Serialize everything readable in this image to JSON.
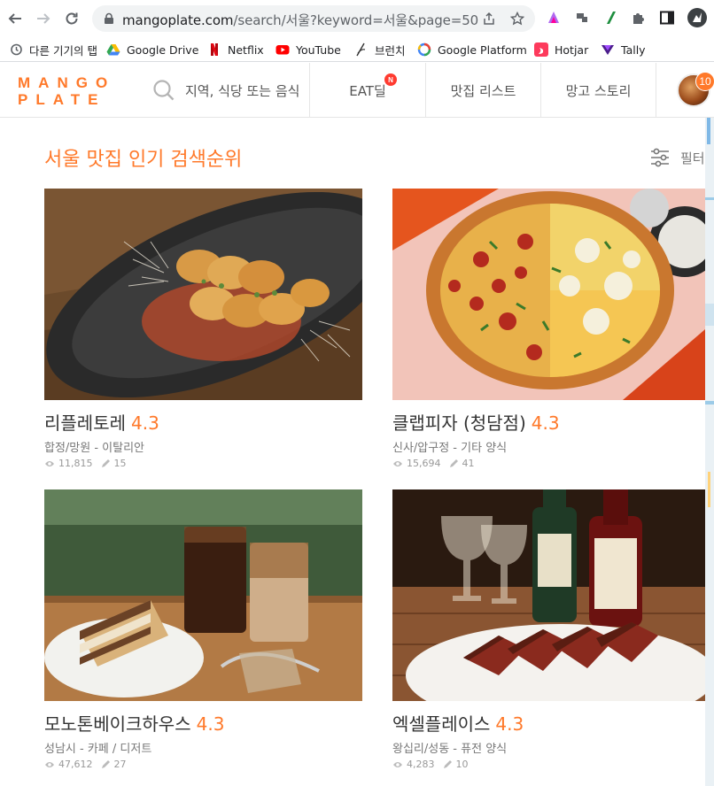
{
  "browser": {
    "url_host": "mangoplate.com",
    "url_path": "/search/서울?keyword=서울&page=50",
    "bookmarks": [
      {
        "label": "다른 기기의 탭",
        "icon": "history-icon"
      },
      {
        "label": "Google Drive",
        "icon": "google-drive-icon"
      },
      {
        "label": "Netflix",
        "icon": "netflix-icon"
      },
      {
        "label": "YouTube",
        "icon": "youtube-icon"
      },
      {
        "label": "브런치",
        "icon": "brunch-icon"
      },
      {
        "label": "Google Platform",
        "icon": "google-platform-icon"
      },
      {
        "label": "Hotjar",
        "icon": "hotjar-icon"
      },
      {
        "label": "Tally",
        "icon": "tally-icon"
      }
    ]
  },
  "header": {
    "logo_line1": "MANGO",
    "logo_line2": "PLATE",
    "search_placeholder": "지역, 식당 또는 음식",
    "nav": [
      {
        "label": "EAT딜",
        "badge": "N"
      },
      {
        "label": "맛집 리스트"
      },
      {
        "label": "망고 스토리"
      }
    ],
    "avatar_badge": "10"
  },
  "main": {
    "title": "서울 맛집 인기 검색순위",
    "filter_label": "필터",
    "restaurants": [
      {
        "name": "리플레토레",
        "score": "4.3",
        "meta": "합정/망원 - 이탈리안",
        "views": "11,815",
        "reviews": "15"
      },
      {
        "name": "클랩피자 (청담점)",
        "score": "4.3",
        "meta": "신사/압구정 - 기타 양식",
        "views": "15,694",
        "reviews": "41"
      },
      {
        "name": "모노톤베이크하우스",
        "score": "4.3",
        "meta": "성남시 - 카페 / 디저트",
        "views": "47,612",
        "reviews": "27"
      },
      {
        "name": "엑셀플레이스",
        "score": "4.3",
        "meta": "왕십리/성동 - 퓨전 양식",
        "views": "4,283",
        "reviews": "10"
      }
    ]
  },
  "colors": {
    "brand": "#ff792a",
    "text": "#333333",
    "meta": "#777777"
  }
}
